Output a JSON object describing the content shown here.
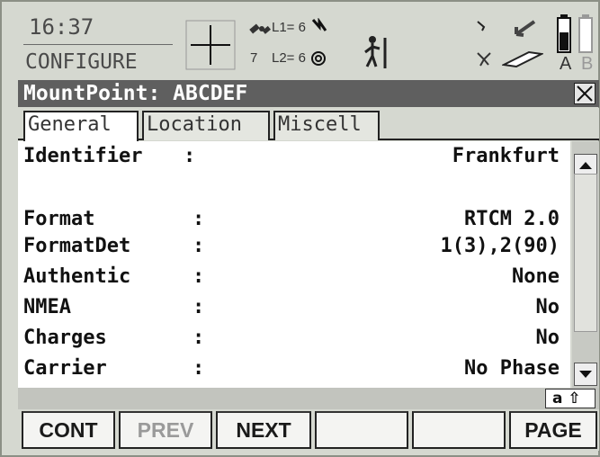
{
  "status": {
    "time": "16:37",
    "mode": "CONFIGURE",
    "l1_label": "L1= 6",
    "l2_label": "L2= 6",
    "satellites": "7",
    "battery_a": "A",
    "battery_b": "B"
  },
  "dialog": {
    "title": "MountPoint: ABCDEF",
    "close_symbol": "✕"
  },
  "tabs": [
    {
      "label": "General",
      "active": true
    },
    {
      "label": "Location",
      "active": false
    },
    {
      "label": "Miscell",
      "active": false
    }
  ],
  "fields": [
    {
      "label": "Identifier",
      "colon": ":",
      "value": "Frankfurt"
    },
    {
      "label": "Format",
      "colon": ":",
      "value": "RTCM 2.0"
    },
    {
      "label": "FormatDet",
      "colon": ":",
      "value": "1(3),2(90)"
    },
    {
      "label": "Authentic",
      "colon": ":",
      "value": "None"
    },
    {
      "label": "NMEA",
      "colon": ":",
      "value": "No"
    },
    {
      "label": "Charges",
      "colon": ":",
      "value": "No"
    },
    {
      "label": "Carrier",
      "colon": ":",
      "value": "No Phase"
    }
  ],
  "input_indicator": "a ⇧",
  "fkeys": [
    {
      "label": "CONT",
      "enabled": true
    },
    {
      "label": "PREV",
      "enabled": false
    },
    {
      "label": "NEXT",
      "enabled": true
    },
    {
      "label": "",
      "enabled": false
    },
    {
      "label": "",
      "enabled": false
    },
    {
      "label": "PAGE",
      "enabled": true
    }
  ],
  "icons": {
    "position": "crosshair-icon",
    "satellite": "satellite-icon",
    "radio": "radio-link-icon",
    "antenna": "antenna-icon",
    "surveyor": "surveyor-icon",
    "memory": "memory-card-icon",
    "battery": "battery-icon"
  },
  "colors": {
    "title_bg": "#5f5f5f",
    "content_bg": "#ffffff",
    "screen_bg": "#d5d8d0"
  }
}
